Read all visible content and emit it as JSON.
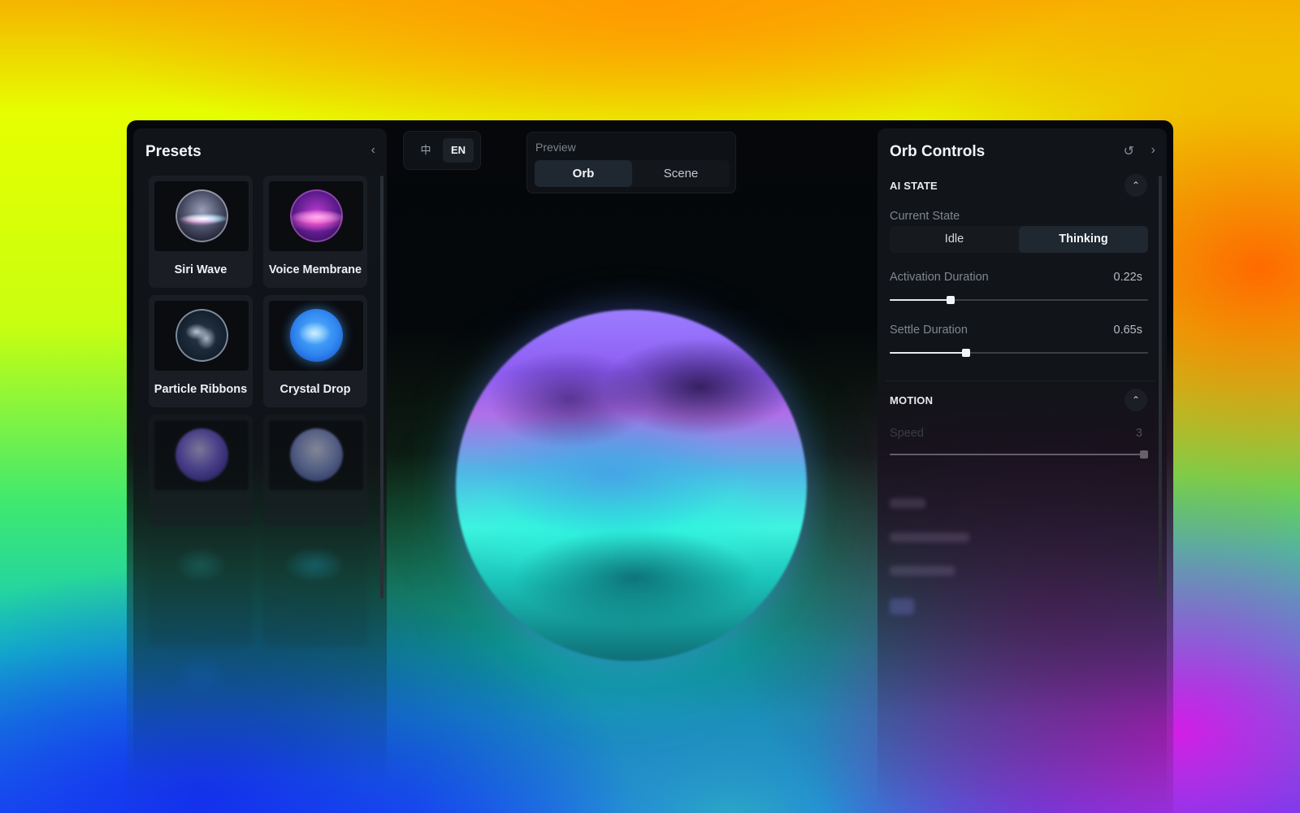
{
  "presets_panel": {
    "title": "Presets",
    "collapse_icon": "chevron-left-icon",
    "items": [
      {
        "label": "Siri Wave",
        "colors": [
          "#d6dbe6",
          "#5a5f78",
          "#1e1f30",
          "#e88bd6",
          "#6fd3ff"
        ]
      },
      {
        "label": "Voice Membrane",
        "colors": [
          "#ff6fd8",
          "#c03cc8",
          "#5a1a8a",
          "#2a0f45"
        ]
      },
      {
        "label": "Particle Ribbons",
        "colors": [
          "#c9d6e6",
          "#2a3a4a",
          "#0b1522"
        ]
      },
      {
        "label": "Crystal Drop",
        "colors": [
          "#bfe6ff",
          "#3ea2ff",
          "#1a5fd8",
          "#0d2e7a"
        ]
      },
      {
        "label": "",
        "colors": [
          "#bfb3ff",
          "#6d57e0",
          "#2c1f8a"
        ]
      },
      {
        "label": "",
        "colors": [
          "#c6cff2",
          "#7f8fd8",
          "#3e4a9e"
        ]
      },
      {
        "label": "",
        "colors": [
          "#2b9aa0",
          "#12646a"
        ]
      },
      {
        "label": "",
        "colors": [
          "#20b7e8",
          "#0e6fa3"
        ]
      },
      {
        "label": "",
        "colors": [
          "#1e72e0",
          "#0a3f96"
        ]
      }
    ]
  },
  "language_toggle": {
    "options": [
      "中",
      "EN"
    ],
    "selected": "EN"
  },
  "preview": {
    "label": "Preview",
    "options": [
      "Orb",
      "Scene"
    ],
    "selected": "Orb"
  },
  "controls_panel": {
    "title": "Orb Controls",
    "reset_icon": "reset-icon",
    "next_icon": "chevron-right-icon",
    "ai_state": {
      "section_title": "AI STATE",
      "current_state_label": "Current State",
      "states": [
        "Idle",
        "Thinking"
      ],
      "selected_state": "Thinking",
      "activation_label": "Activation Duration",
      "activation_value": "0.22s",
      "activation_fraction": 0.235,
      "settle_label": "Settle Duration",
      "settle_value": "0.65s",
      "settle_fraction": 0.295
    },
    "motion": {
      "section_title": "MOTION",
      "speed_label": "Speed",
      "speed_value": "3",
      "speed_fraction": 0.985
    }
  },
  "colors": {
    "accent": "#1f2731",
    "panel_bg": "#111418",
    "text_primary": "#f2f4f6",
    "text_muted": "#7f8690"
  }
}
